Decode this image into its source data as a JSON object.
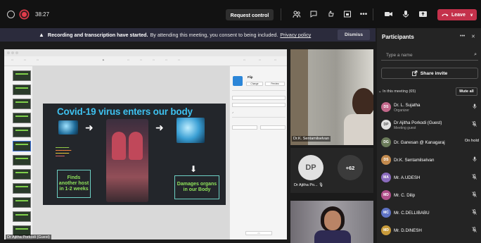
{
  "topbar": {
    "timer": "38:27",
    "request_control": "Request control",
    "leave_label": "Leave"
  },
  "banner": {
    "strong": "Recording and transcription have started.",
    "text": "By attending this meeting, you consent to being included.",
    "link": "Privacy policy",
    "dismiss": "Dismiss"
  },
  "stage": {
    "slide_title": "Covid-19 virus enters our body",
    "box_left": "Finds another host in 1-2 weeks",
    "box_right": "Damages organs in our Body",
    "transition_name": "Flip",
    "change_label": "Change",
    "preview_label": "Preview",
    "presenter_name": "Dr Ajitha Porkodi (Guest)"
  },
  "videos": {
    "ks_name": "Dr.K. Sentamilselvan",
    "dp_initials": "DP",
    "more_count": "+62",
    "dp_name": "Dr Ajitha Po..."
  },
  "panel": {
    "title": "Participants",
    "search_placeholder": "Type a name",
    "share_invite": "Share invite",
    "in_meeting": "In this meeting (65)",
    "mute_all": "Mute all",
    "participants": [
      {
        "initials": "DS",
        "name": "Dr. L. Sujatha",
        "sub": "Organizer",
        "color": "#c2678a",
        "status": "mic"
      },
      {
        "initials": "DP",
        "name": "Dr Ajitha Porkodi (Guest)",
        "sub": "Meeting guest",
        "color": "#e1e1e1",
        "status": "mic-off"
      },
      {
        "initials": "DG",
        "name": "Dr. Ganesan @ Kanagaraj",
        "sub": "",
        "color": "#6a7a5a",
        "status": "On hold"
      },
      {
        "initials": "DS",
        "name": "Dr.K. Sentamilselvan",
        "sub": "",
        "color": "#c28a4e",
        "status": "mic"
      },
      {
        "initials": "MA",
        "name": "Mr. A.UDESH",
        "sub": "",
        "color": "#8a6bbd",
        "status": "mic-off"
      },
      {
        "initials": "MD",
        "name": "Mr. C. Dilip",
        "sub": "",
        "color": "#b04f8a",
        "status": "mic-off"
      },
      {
        "initials": "MC",
        "name": "Mr. C.DELLIBABU",
        "sub": "",
        "color": "#5f73c4",
        "status": "mic-off"
      },
      {
        "initials": "MD",
        "name": "Mr. D.DINESH",
        "sub": "",
        "color": "#c79a3a",
        "status": "mic-off"
      }
    ]
  }
}
